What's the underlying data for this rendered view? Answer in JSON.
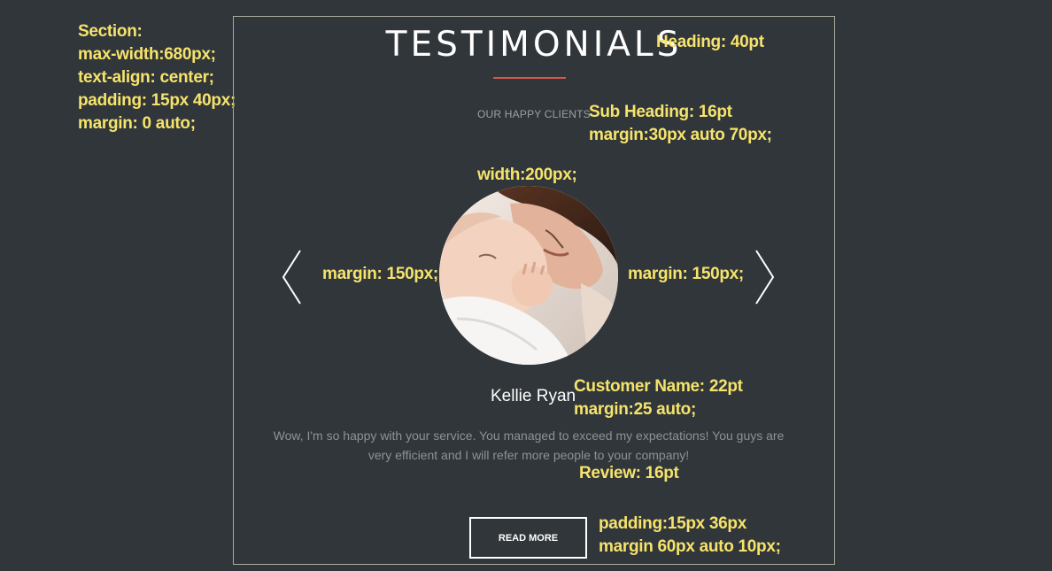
{
  "section": {
    "heading": "TESTIMONIALS",
    "subheading": "OUR HAPPY CLIENTS",
    "customer_name": "Kellie Ryan",
    "review": "Wow, I'm so happy with your service. You managed to exceed my expectations! You guys are very efficient and I will refer more people to your company!",
    "button_label": "READ MORE",
    "photo_alt": "mother-and-baby-photo",
    "arrow_left_icon": "chevron-left-icon",
    "arrow_right_icon": "chevron-right-icon"
  },
  "annotations": {
    "section_spec": [
      "Section:",
      "max-width:680px;",
      "text-align: center;",
      "padding: 15px 40px;",
      "margin: 0 auto;"
    ],
    "heading_spec": "Heading: 40pt",
    "subheading_spec": [
      "Sub Heading: 16pt",
      "margin:30px auto 70px;"
    ],
    "photo_width_spec": "width:200px;",
    "margin_left_spec": "margin: 150px;",
    "margin_right_spec": "margin: 150px;",
    "customer_name_spec": [
      "Customer Name: 22pt",
      "margin:25 auto;"
    ],
    "review_spec": "Review: 16pt",
    "button_spec": [
      "padding:15px 36px",
      "margin 60px auto 10px;"
    ]
  },
  "colors": {
    "background": "#30363a",
    "annotation": "#f6e36b",
    "accent_divider": "#d8584a",
    "border": "#a9ab9b"
  }
}
